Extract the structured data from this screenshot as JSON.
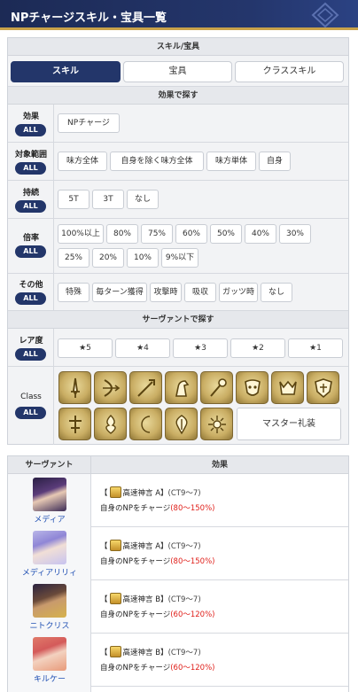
{
  "header": {
    "title": "NPチャージスキル・宝具一覧"
  },
  "filters": {
    "category_header": "スキル/宝具",
    "tabs": [
      "スキル",
      "宝具",
      "クラススキル"
    ],
    "effect_header": "効果で探す",
    "all_label": "ALL",
    "effect": {
      "label": "効果",
      "options": [
        "NPチャージ"
      ]
    },
    "target": {
      "label": "対象範囲",
      "options": [
        "味方全体",
        "自身を除く味方全体",
        "味方単体",
        "自身"
      ]
    },
    "duration": {
      "label": "持続",
      "options": [
        "5T",
        "3T",
        "なし"
      ]
    },
    "rate": {
      "label": "倍率",
      "options": [
        "100%以上",
        "80%",
        "75%",
        "60%",
        "50%",
        "40%",
        "30%",
        "25%",
        "20%",
        "10%",
        "9%以下"
      ]
    },
    "other": {
      "label": "その他",
      "options": [
        "特殊",
        "毎ターン獲得",
        "攻撃時",
        "吸収",
        "ガッツ時",
        "なし"
      ]
    },
    "servant_header": "サーヴァントで探す",
    "rarity": {
      "label": "レア度",
      "options": [
        "★5",
        "★4",
        "★3",
        "★2",
        "★1"
      ]
    },
    "class": {
      "label": "Class",
      "icons": [
        "saber-class-icon",
        "archer-class-icon",
        "lancer-class-icon",
        "rider-class-icon",
        "caster-class-icon",
        "assassin-class-icon",
        "berserker-class-icon",
        "shielder-class-icon",
        "ruler-class-icon",
        "avenger-class-icon",
        "mooncancer-class-icon",
        "alterego-class-icon",
        "foreigner-class-icon"
      ],
      "master_label": "マスター礼装"
    }
  },
  "table": {
    "col_servant": "サーヴァント",
    "col_effect": "効果",
    "rows": [
      {
        "name": "メディア",
        "skill_prefix": "【",
        "skill": "高速神言 A】",
        "ct": "(CT9〜7)",
        "desc": "自身のNPをチャージ",
        "pct": "(80〜150%)"
      },
      {
        "name": "メディアリリィ",
        "skill_prefix": "【",
        "skill": "高速神言 A】",
        "ct": "(CT9〜7)",
        "desc": "自身のNPをチャージ",
        "pct": "(80〜150%)"
      },
      {
        "name": "ニトクリス",
        "skill_prefix": "【",
        "skill": "高速神言 B】",
        "ct": "(CT9〜7)",
        "desc": "自身のNPをチャージ",
        "pct": "(60〜120%)"
      },
      {
        "name": "キルケー",
        "skill_prefix": "【",
        "skill": "高速神言 B】",
        "ct": "(CT9〜7)",
        "desc": "自身のNPをチャージ",
        "pct": "(60〜120%)"
      }
    ]
  },
  "colors": {
    "navy": "#23366a",
    "accent_gold": "#c8a24a",
    "percent_red": "#e0201b",
    "link_blue": "#1f4fb3"
  }
}
